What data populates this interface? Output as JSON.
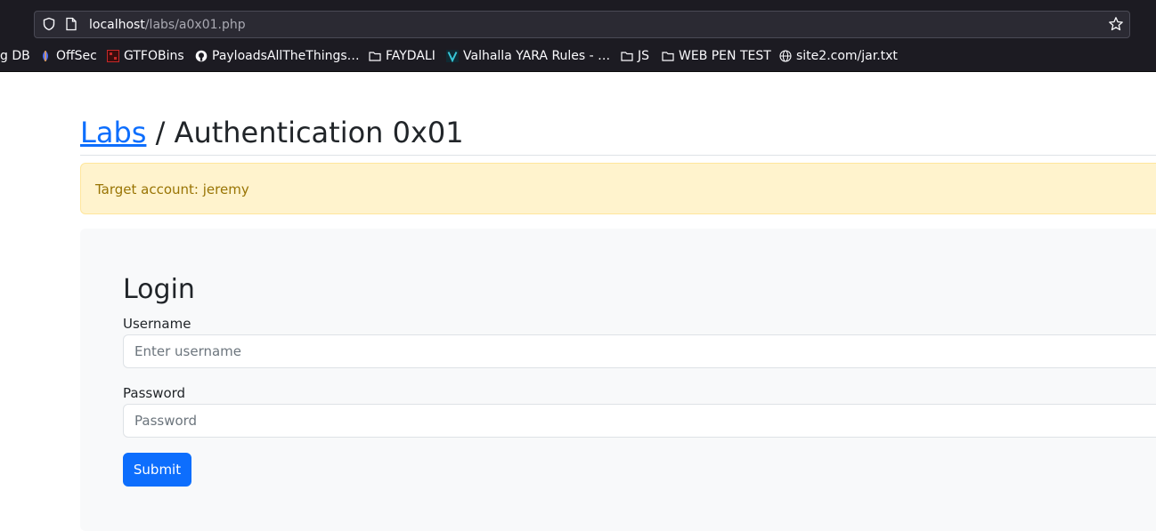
{
  "browser": {
    "url_host": "localhost",
    "url_path": "/labs/a0x01.php",
    "bookmarks": [
      {
        "label": "g DB",
        "icon": "none"
      },
      {
        "label": "OffSec",
        "icon": "offsec-icon"
      },
      {
        "label": "GTFOBins",
        "icon": "gtfobins-icon"
      },
      {
        "label": "PayloadsAllTheThings…",
        "icon": "github-icon"
      },
      {
        "label": "FAYDALI",
        "icon": "folder-icon"
      },
      {
        "label": "Valhalla YARA Rules - …",
        "icon": "valhalla-icon"
      },
      {
        "label": "JS",
        "icon": "folder-icon"
      },
      {
        "label": "WEB PEN TEST",
        "icon": "folder-icon"
      },
      {
        "label": "site2.com/jar.txt",
        "icon": "globe-icon"
      }
    ]
  },
  "page": {
    "breadcrumb_link": "Labs",
    "breadcrumb_separator": " / ",
    "title": "Authentication 0x01",
    "alert": "Target account: jeremy",
    "login": {
      "title": "Login",
      "username_label": "Username",
      "username_placeholder": "Enter username",
      "password_label": "Password",
      "password_placeholder": "Password",
      "submit_label": "Submit"
    }
  },
  "colors": {
    "primary": "#0d6efd",
    "alert_bg": "#fff3cd",
    "alert_text": "#997404",
    "chrome_bg": "#1c1b22"
  }
}
